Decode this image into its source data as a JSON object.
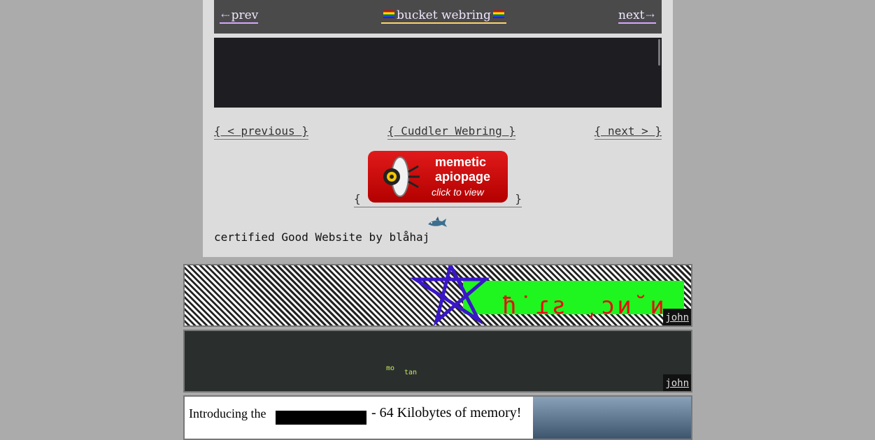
{
  "bucket": {
    "prev": "prev",
    "prev_icon": "⇠",
    "title": "bucket webring",
    "next": "next",
    "next_icon": "⇢"
  },
  "cuddler": {
    "prev": "{ < previous }",
    "title": "{ Cuddler Webring }",
    "next": "{ next > }"
  },
  "apiopage": {
    "open": "{",
    "close": "}",
    "line1": "memetic",
    "line2": "apiopage",
    "line3": "click to view"
  },
  "blahaj": {
    "text": "certified Good Website by blåhaj"
  },
  "banners": {
    "john1": "john",
    "glyphs": "ħ˙ɾƨ ͵ɔи˘и",
    "john2": "john",
    "mo1": "mo",
    "mo2": "tan",
    "ad_left": "Introducing the",
    "ad_right": "- 64 Kilobytes of memory!"
  }
}
